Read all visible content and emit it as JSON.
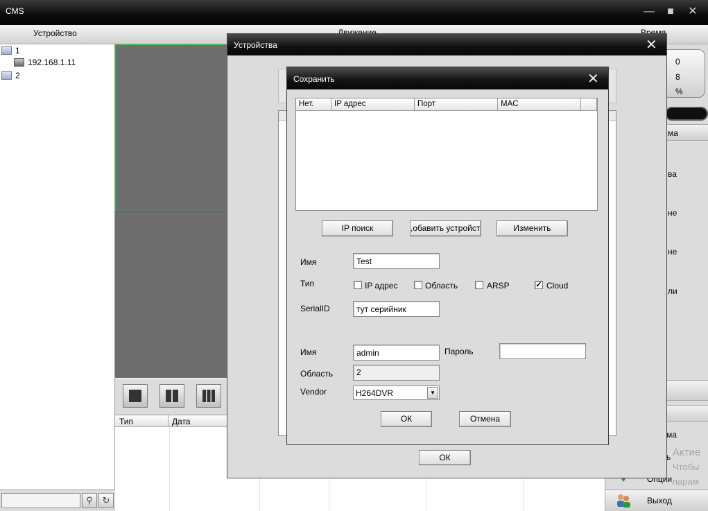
{
  "app": {
    "title": "CMS"
  },
  "header": {
    "device_col": "Устройство",
    "motion_col": "Движение",
    "time_col": "Время"
  },
  "tree": [
    {
      "label": "1"
    },
    {
      "label": "192.168.1.11"
    },
    {
      "label": "2"
    }
  ],
  "log_table": {
    "columns": [
      "Тип",
      "Дата"
    ]
  },
  "right_panel": {
    "disc_values": [
      "0",
      "8",
      "%"
    ],
    "items": [
      "ма",
      "ва",
      "не",
      "не",
      "ли",
      "ма",
      "ь",
      "Опции"
    ],
    "exit_label": "Выход",
    "watermark": [
      "Актие",
      "Чтобы",
      "парам"
    ]
  },
  "devices_dialog": {
    "title": "Устройства",
    "ok_label": "ОК"
  },
  "save_dialog": {
    "title": "Сохранить",
    "table_columns": [
      "Нет.",
      "IP адрес",
      "Порт",
      "MAC"
    ],
    "ip_search_label": "IP поиск",
    "add_device_label": ",обавить устройств",
    "change_label": "Изменить",
    "name_label": "Имя",
    "name_value": "Test",
    "type_label": "Тип",
    "type_options": [
      {
        "label": "IP адрес",
        "checked": false
      },
      {
        "label": "Область",
        "checked": false
      },
      {
        "label": "ARSP",
        "checked": false
      },
      {
        "label": "Cloud",
        "checked": true
      }
    ],
    "serial_label": "SerialID",
    "serial_value": "тут серийник",
    "user_label": "Имя",
    "user_value": "admin",
    "password_label": "Пароль",
    "password_value": "",
    "area_label": "Область",
    "area_value": "2",
    "vendor_label": "Vendor",
    "vendor_value": "H264DVR",
    "ok_label": "ОК",
    "cancel_label": "Отмена"
  }
}
